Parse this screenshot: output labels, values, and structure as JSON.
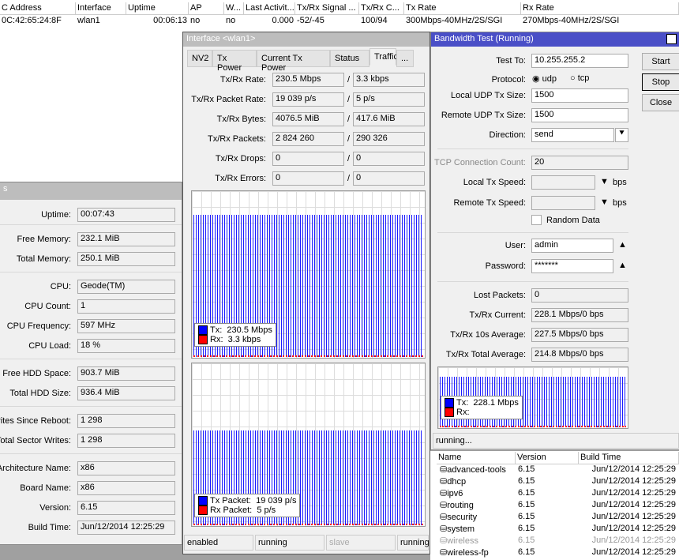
{
  "top_table": {
    "headers": [
      "C Address",
      "Interface",
      "Uptime",
      "AP",
      "W...",
      "Last Activit...",
      "Tx/Rx Signal ...",
      "Tx/Rx C...",
      "Tx Rate",
      "Rx Rate"
    ],
    "row": [
      "0C:42:65:24:8F",
      "wlan1",
      "00:06:13",
      "no",
      "no",
      "0.000",
      "-52/-45",
      "100/94",
      "300Mbps-40MHz/2S/SGI",
      "270Mbps-40MHz/2S/SGI"
    ]
  },
  "resources": {
    "title": "s",
    "fields": [
      {
        "label": "Uptime:",
        "value": "00:07:43"
      },
      {
        "label": "Free Memory:",
        "value": "232.1 MiB"
      },
      {
        "label": "Total Memory:",
        "value": "250.1 MiB"
      },
      {
        "label": "CPU:",
        "value": "Geode(TM)"
      },
      {
        "label": "CPU Count:",
        "value": "1"
      },
      {
        "label": "CPU Frequency:",
        "value": "597 MHz"
      },
      {
        "label": "CPU Load:",
        "value": "18 %"
      },
      {
        "label": "Free HDD Space:",
        "value": "903.7 MiB"
      },
      {
        "label": "Total HDD Size:",
        "value": "936.4 MiB"
      },
      {
        "label": "rites Since Reboot:",
        "value": "1 298"
      },
      {
        "label": "Total Sector Writes:",
        "value": "1 298"
      },
      {
        "label": "Architecture Name:",
        "value": "x86"
      },
      {
        "label": "Board Name:",
        "value": "x86"
      },
      {
        "label": "Version:",
        "value": "6.15"
      },
      {
        "label": "Build Time:",
        "value": "Jun/12/2014 12:25:29"
      }
    ]
  },
  "interface": {
    "title": "Interface <wlan1>",
    "tabs": [
      "NV2",
      "Tx Power",
      "Current Tx Power",
      "Status",
      "Traffic",
      "..."
    ],
    "active_tab": "Traffic",
    "fields": [
      {
        "label": "Tx/Rx Rate:",
        "tx": "230.5 Mbps",
        "rx": "3.3 kbps"
      },
      {
        "label": "Tx/Rx Packet Rate:",
        "tx": "19 039 p/s",
        "rx": "5 p/s"
      },
      {
        "label": "Tx/Rx Bytes:",
        "tx": "4076.5 MiB",
        "rx": "417.6 MiB"
      },
      {
        "label": "Tx/Rx Packets:",
        "tx": "2 824 260",
        "rx": "290 326"
      },
      {
        "label": "Tx/Rx Drops:",
        "tx": "0",
        "rx": "0"
      },
      {
        "label": "Tx/Rx Errors:",
        "tx": "0",
        "rx": "0"
      }
    ],
    "graph1": {
      "tx_label": "Tx:",
      "tx_value": "230.5 Mbps",
      "rx_label": "Rx:",
      "rx_value": "3.3 kbps"
    },
    "graph2": {
      "tx_label": "Tx Packet:",
      "tx_value": "19 039 p/s",
      "rx_label": "Rx Packet:",
      "rx_value": "5 p/s"
    },
    "status": [
      "enabled",
      "running",
      "slave",
      "running"
    ]
  },
  "bandwidth": {
    "title": "Bandwidth Test (Running)",
    "test_to_label": "Test To:",
    "test_to": "10.255.255.2",
    "protocol_label": "Protocol:",
    "protocol_options": [
      "udp",
      "tcp"
    ],
    "protocol": "udp",
    "local_udp_label": "Local UDP Tx Size:",
    "local_udp": "1500",
    "remote_udp_label": "Remote UDP Tx Size:",
    "remote_udp": "1500",
    "direction_label": "Direction:",
    "direction": "send",
    "tcp_count_label": "TCP Connection Count:",
    "tcp_count": "20",
    "local_speed_label": "Local Tx Speed:",
    "remote_speed_label": "Remote Tx Speed:",
    "unit": "bps",
    "random_label": "Random Data",
    "user_label": "User:",
    "user": "admin",
    "password_label": "Password:",
    "password": "*******",
    "lost_label": "Lost Packets:",
    "lost": "0",
    "current_label": "Tx/Rx Current:",
    "current": "228.1 Mbps/0 bps",
    "avg10_label": "Tx/Rx 10s Average:",
    "avg10": "227.5 Mbps/0 bps",
    "total_label": "Tx/Rx Total Average:",
    "total": "214.8 Mbps/0 bps",
    "graph": {
      "tx_label": "Tx:",
      "tx_value": "228.1 Mbps",
      "rx_label": "Rx:"
    },
    "buttons": {
      "start": "Start",
      "stop": "Stop",
      "close": "Close"
    },
    "status": "running...",
    "colors": {
      "tx": "#0000ff",
      "rx": "#ff0000",
      "title": "#4a4fc7"
    }
  },
  "packages": {
    "headers": [
      "Name",
      "Version",
      "Build Time"
    ],
    "rows": [
      {
        "name": "advanced-tools",
        "version": "6.15",
        "build": "Jun/12/2014 12:25:29"
      },
      {
        "name": "dhcp",
        "version": "6.15",
        "build": "Jun/12/2014 12:25:29"
      },
      {
        "name": "ipv6",
        "version": "6.15",
        "build": "Jun/12/2014 12:25:29"
      },
      {
        "name": "routing",
        "version": "6.15",
        "build": "Jun/12/2014 12:25:29"
      },
      {
        "name": "security",
        "version": "6.15",
        "build": "Jun/12/2014 12:25:29"
      },
      {
        "name": "system",
        "version": "6.15",
        "build": "Jun/12/2014 12:25:29"
      },
      {
        "name": "wireless",
        "version": "6.15",
        "build": "Jun/12/2014 12:25:29",
        "disabled": true
      },
      {
        "name": "wireless-fp",
        "version": "6.15",
        "build": "Jun/12/2014 12:25:29"
      }
    ]
  }
}
